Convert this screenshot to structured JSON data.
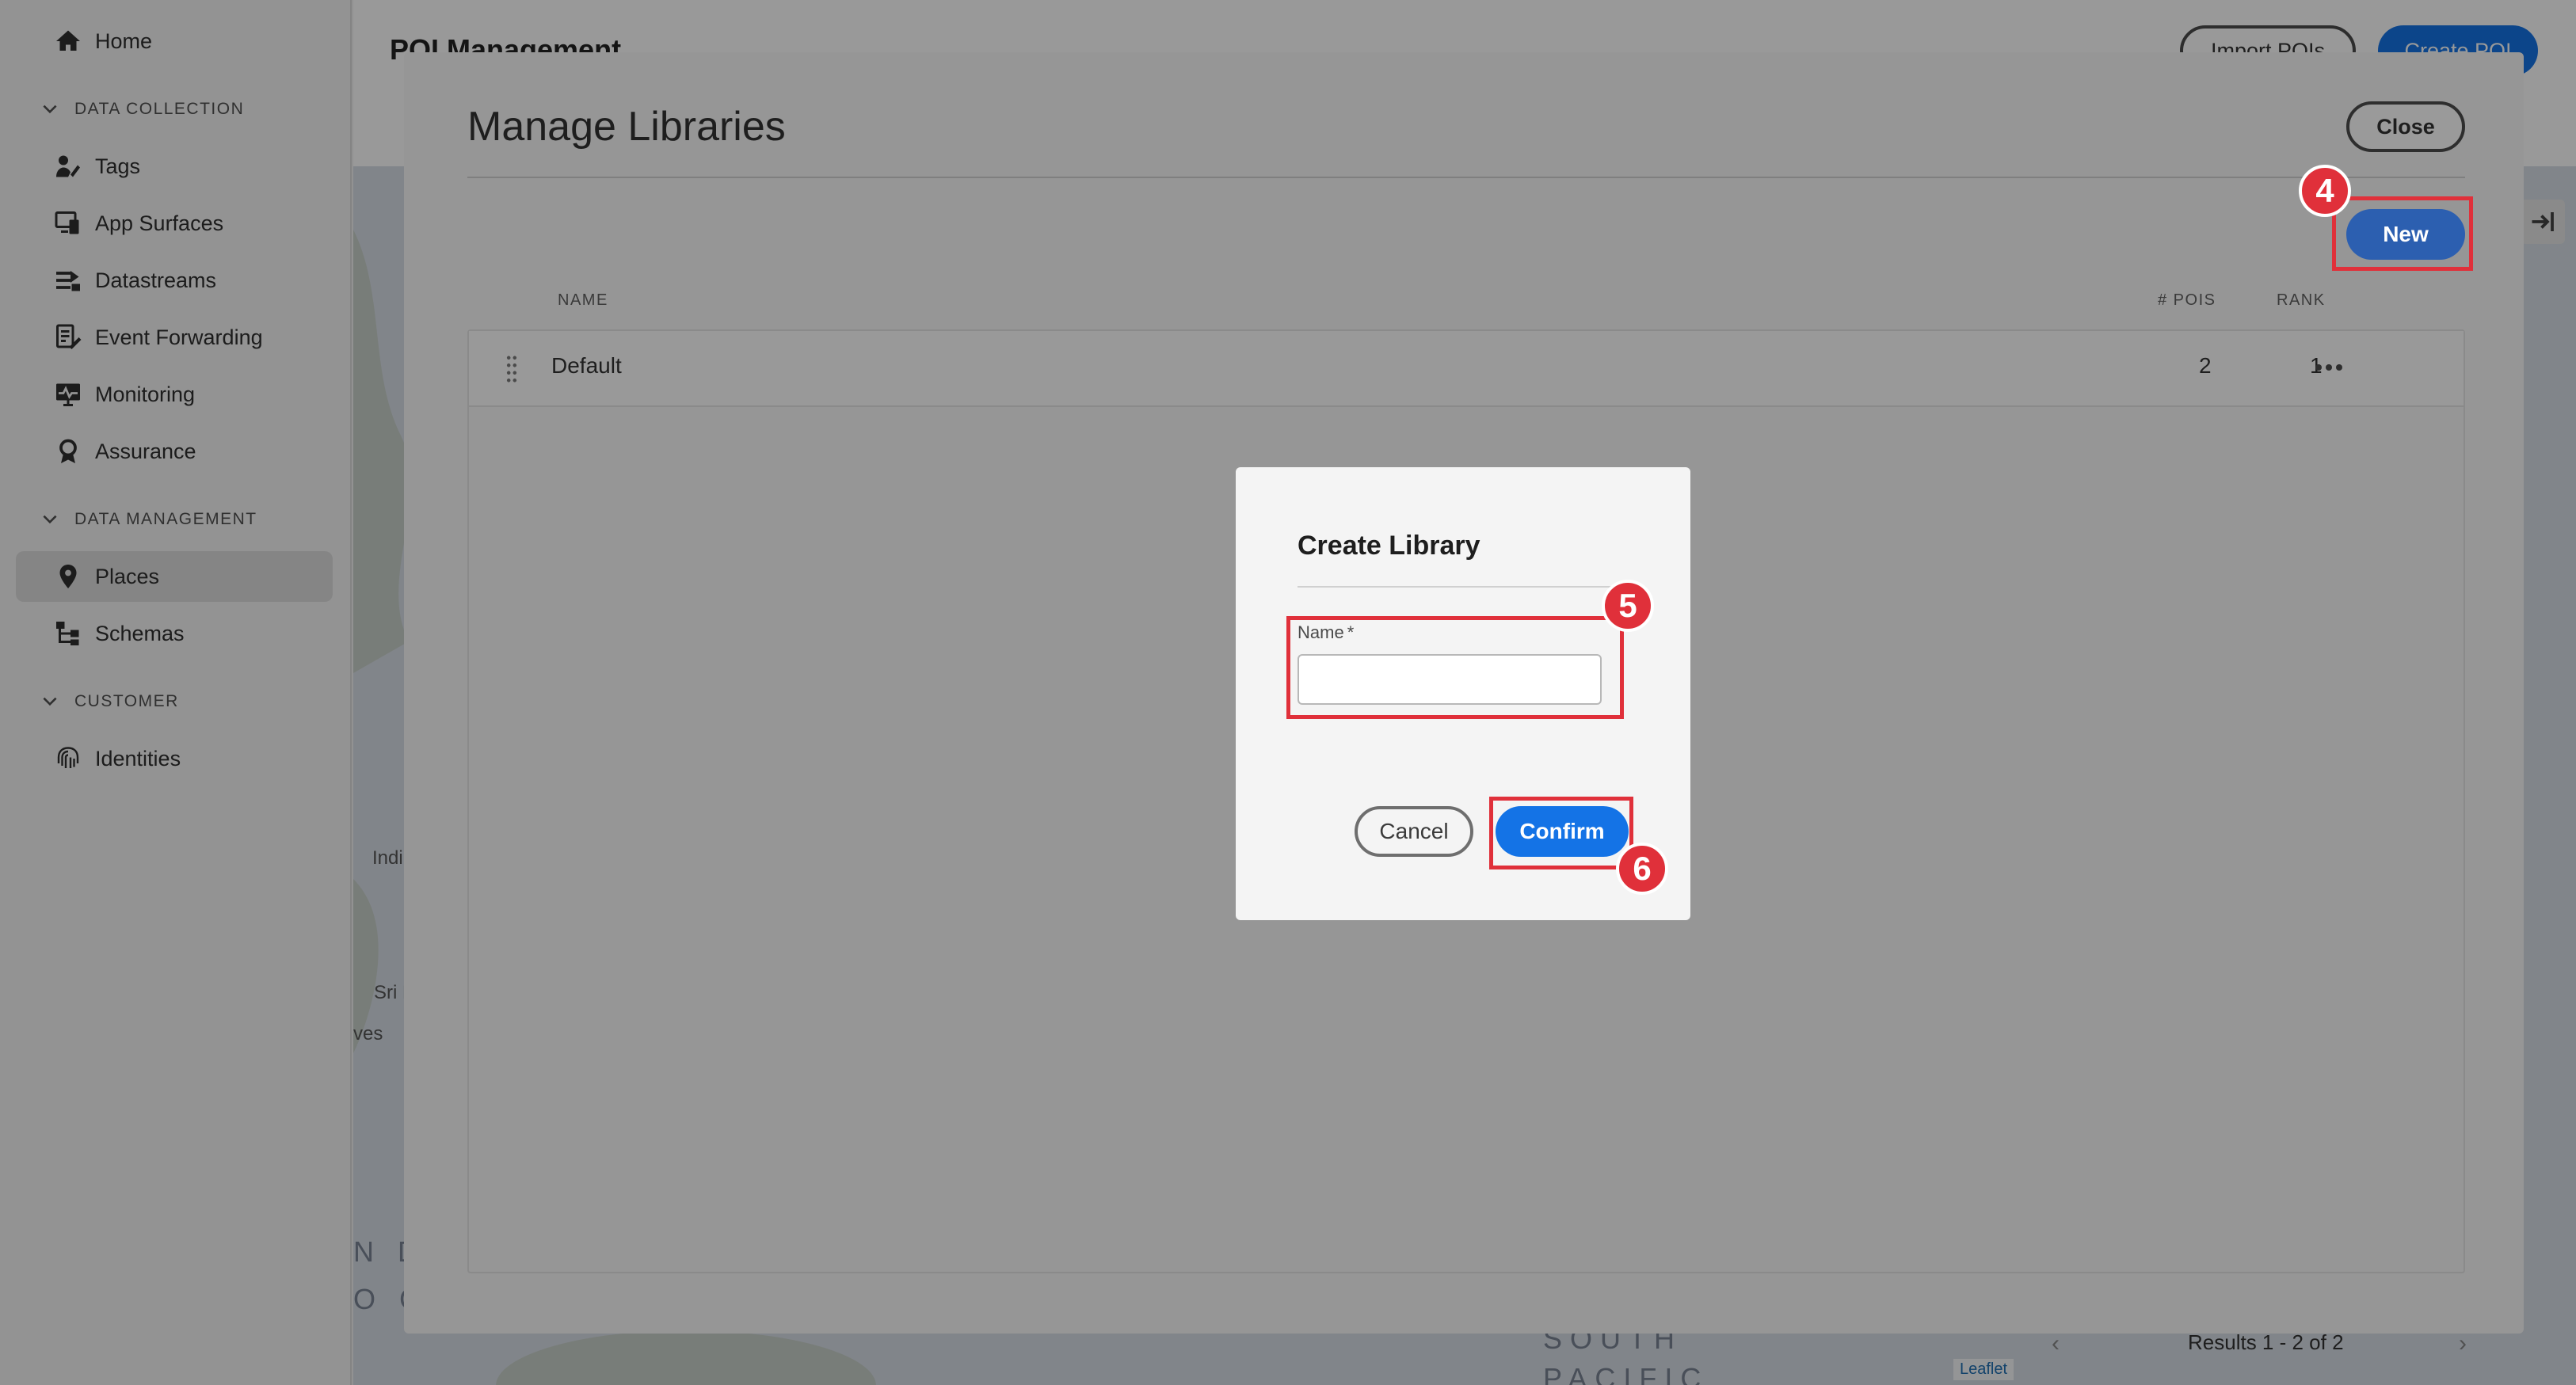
{
  "sidebar": {
    "home": "Home",
    "sections": [
      {
        "label": "DATA COLLECTION"
      },
      {
        "label": "DATA MANAGEMENT"
      },
      {
        "label": "CUSTOMER"
      }
    ],
    "items": [
      {
        "label": "Tags",
        "icon": "tags-icon"
      },
      {
        "label": "App Surfaces",
        "icon": "app-surfaces-icon"
      },
      {
        "label": "Datastreams",
        "icon": "datastreams-icon"
      },
      {
        "label": "Event Forwarding",
        "icon": "event-forwarding-icon"
      },
      {
        "label": "Monitoring",
        "icon": "monitoring-icon"
      },
      {
        "label": "Assurance",
        "icon": "assurance-icon"
      },
      {
        "label": "Places",
        "icon": "places-icon",
        "active": true
      },
      {
        "label": "Schemas",
        "icon": "schemas-icon"
      },
      {
        "label": "Identities",
        "icon": "identities-icon"
      }
    ]
  },
  "background_page": {
    "title": "POI Management",
    "import_button": "Import POIs",
    "create_button": "Create POI",
    "map_labels": [
      "Indi",
      "Sri L",
      "ves",
      "N D",
      "O C",
      "SOUTH",
      "PACIFIC"
    ],
    "results_text": "Results 1 - 2 of 2",
    "leaflet_credit": "Leaflet"
  },
  "manage_dialog": {
    "title": "Manage Libraries",
    "close_label": "Close",
    "new_label": "New",
    "columns": {
      "name": "NAME",
      "pois": "# POIS",
      "rank": "RANK"
    },
    "rows": [
      {
        "name": "Default",
        "pois": "2",
        "rank": "1"
      }
    ]
  },
  "create_dialog": {
    "title": "Create Library",
    "name_label": "Name",
    "required_mark": "*",
    "name_value": "",
    "cancel_label": "Cancel",
    "confirm_label": "Confirm"
  },
  "annotations": {
    "steps": [
      "4",
      "5",
      "6"
    ],
    "color": "#e0303a"
  },
  "colors": {
    "accent_blue": "#1473e6",
    "overlay_dim": "rgba(0,0,0,0.40)"
  }
}
